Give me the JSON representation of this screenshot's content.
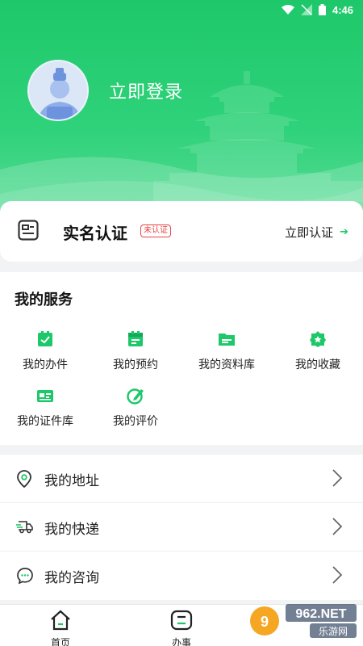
{
  "status_bar": {
    "time": "4:46"
  },
  "profile": {
    "login_text": "立即登录"
  },
  "realname": {
    "title": "实名认证",
    "badge": "未认证",
    "action": "立即认证"
  },
  "services": {
    "title": "我的服务",
    "items": [
      {
        "label": "我的办件",
        "icon": "checklist-icon"
      },
      {
        "label": "我的预约",
        "icon": "calendar-icon"
      },
      {
        "label": "我的资料库",
        "icon": "folder-icon"
      },
      {
        "label": "我的收藏",
        "icon": "star-badge-icon"
      },
      {
        "label": "我的证件库",
        "icon": "id-card-icon"
      },
      {
        "label": "我的评价",
        "icon": "pen-icon"
      }
    ]
  },
  "menu": [
    {
      "label": "我的地址",
      "icon": "location-pin-icon"
    },
    {
      "label": "我的快递",
      "icon": "delivery-truck-icon"
    },
    {
      "label": "我的咨询",
      "icon": "chat-bubble-icon"
    }
  ],
  "tabbar": [
    {
      "label": "首页",
      "icon": "home-icon"
    },
    {
      "label": "办事",
      "icon": "service-icon"
    }
  ],
  "watermark": {
    "text": "962.NET",
    "subtext": "乐游网"
  },
  "colors": {
    "primary": "#1ec86a",
    "badge": "#e64545"
  }
}
